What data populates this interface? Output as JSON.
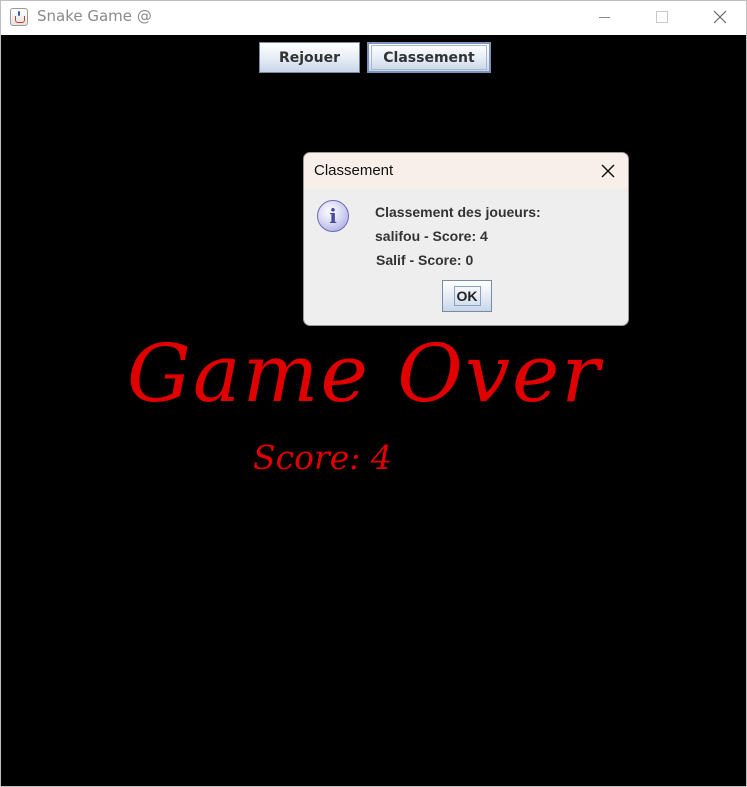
{
  "window": {
    "title": "Snake Game",
    "title_icon": "spiral-at-icon"
  },
  "toolbar": {
    "rejouer_label": "Rejouer",
    "classement_label": "Classement"
  },
  "game": {
    "game_over_text": "Game Over",
    "score_text": "Score: 4",
    "text_color": "#e00000",
    "background_color": "#000000"
  },
  "dialog": {
    "title": "Classement",
    "icon": "info-icon",
    "heading": "Classement des joueurs:",
    "entries": [
      "salifou - Score: 4",
      "Salif - Score: 0"
    ],
    "ok_label": "OK"
  }
}
